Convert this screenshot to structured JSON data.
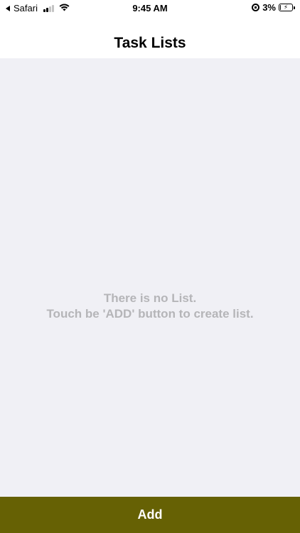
{
  "status_bar": {
    "back_app": "Safari",
    "time": "9:45 AM",
    "battery_percent": "3%",
    "battery_level": 0.03,
    "signal_bars_active": 2,
    "signal_bars_total": 4
  },
  "nav": {
    "title": "Task Lists"
  },
  "empty_state": {
    "line1": "There is no List.",
    "line2": "Touch be 'ADD' button to create list."
  },
  "footer": {
    "add_label": "Add"
  },
  "colors": {
    "content_bg": "#f0f0f5",
    "add_button_bg": "#666104",
    "empty_text": "#b5b5b8"
  }
}
